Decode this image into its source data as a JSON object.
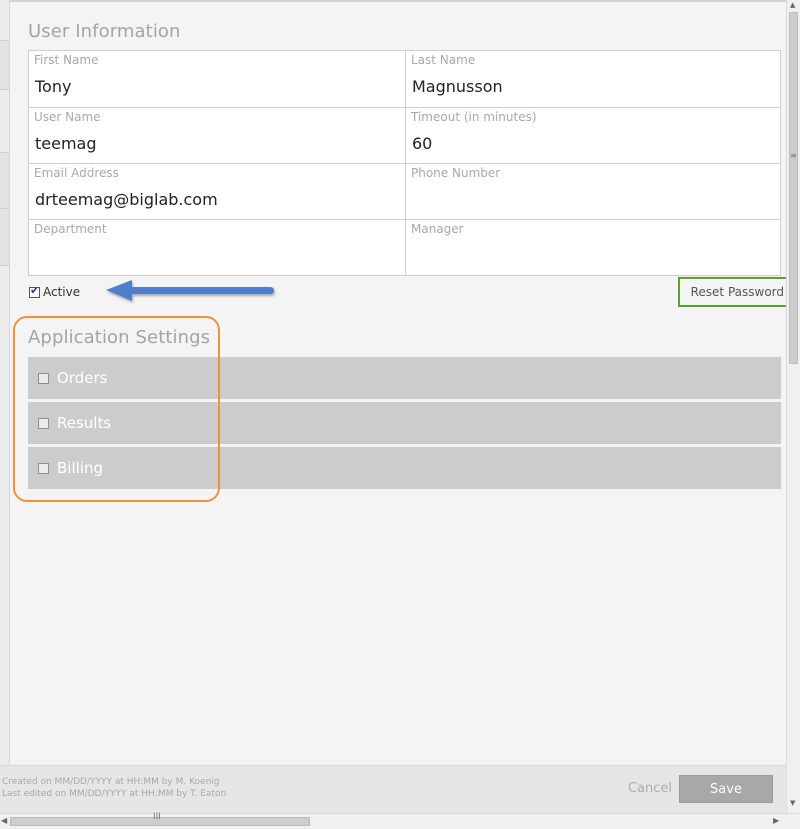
{
  "user_info": {
    "title": "User Information",
    "fields": [
      {
        "label": "First Name",
        "value": "Tony"
      },
      {
        "label": "Last Name",
        "value": "Magnusson"
      },
      {
        "label": "User Name",
        "value": "teemag"
      },
      {
        "label": "Timeout (in minutes)",
        "value": "60"
      },
      {
        "label": "Email Address",
        "value": "drteemag@biglab.com"
      },
      {
        "label": "Phone Number",
        "value": ""
      },
      {
        "label": "Department",
        "value": ""
      },
      {
        "label": "Manager",
        "value": ""
      }
    ]
  },
  "active": {
    "label": "Active",
    "checked": true,
    "check_glyph": "✔"
  },
  "reset_password": {
    "label": "Reset Password"
  },
  "app_settings": {
    "title": "Application Settings",
    "items": [
      {
        "label": "Orders",
        "checked": false
      },
      {
        "label": "Results",
        "checked": false
      },
      {
        "label": "Billing",
        "checked": false
      }
    ]
  },
  "footer": {
    "created": "Created on MM/DD/YYYY at HH:MM by M. Koenig",
    "edited": "Last edited on MM/DD/YYYY at HH:MM by T. Eaton",
    "cancel_label": "Cancel",
    "save_label": "Save"
  },
  "scrollbars": {
    "v_grip": "≡",
    "h_grip": "III",
    "up": "▲",
    "down": "▼",
    "left": "◀",
    "right": "▶"
  },
  "annotations": {
    "arrow_color": "#4f7fcb",
    "reset_box_color": "#5aa229",
    "settings_box_color": "#f0923a"
  }
}
